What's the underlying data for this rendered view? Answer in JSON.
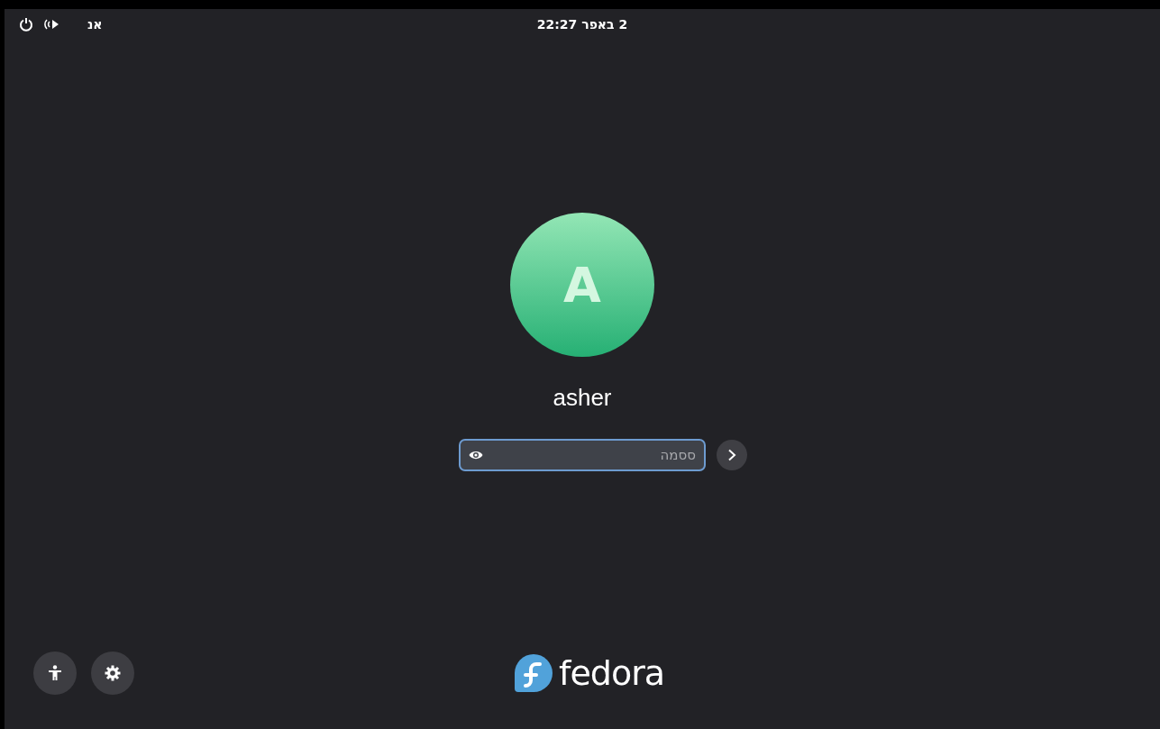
{
  "top_bar": {
    "clock": "2 באפר 22:27",
    "keyboard_layout": "אנ"
  },
  "user": {
    "initial": "A",
    "name": "asher"
  },
  "password": {
    "placeholder": "ססמה",
    "focused": true
  },
  "logo_text": "fedora"
}
